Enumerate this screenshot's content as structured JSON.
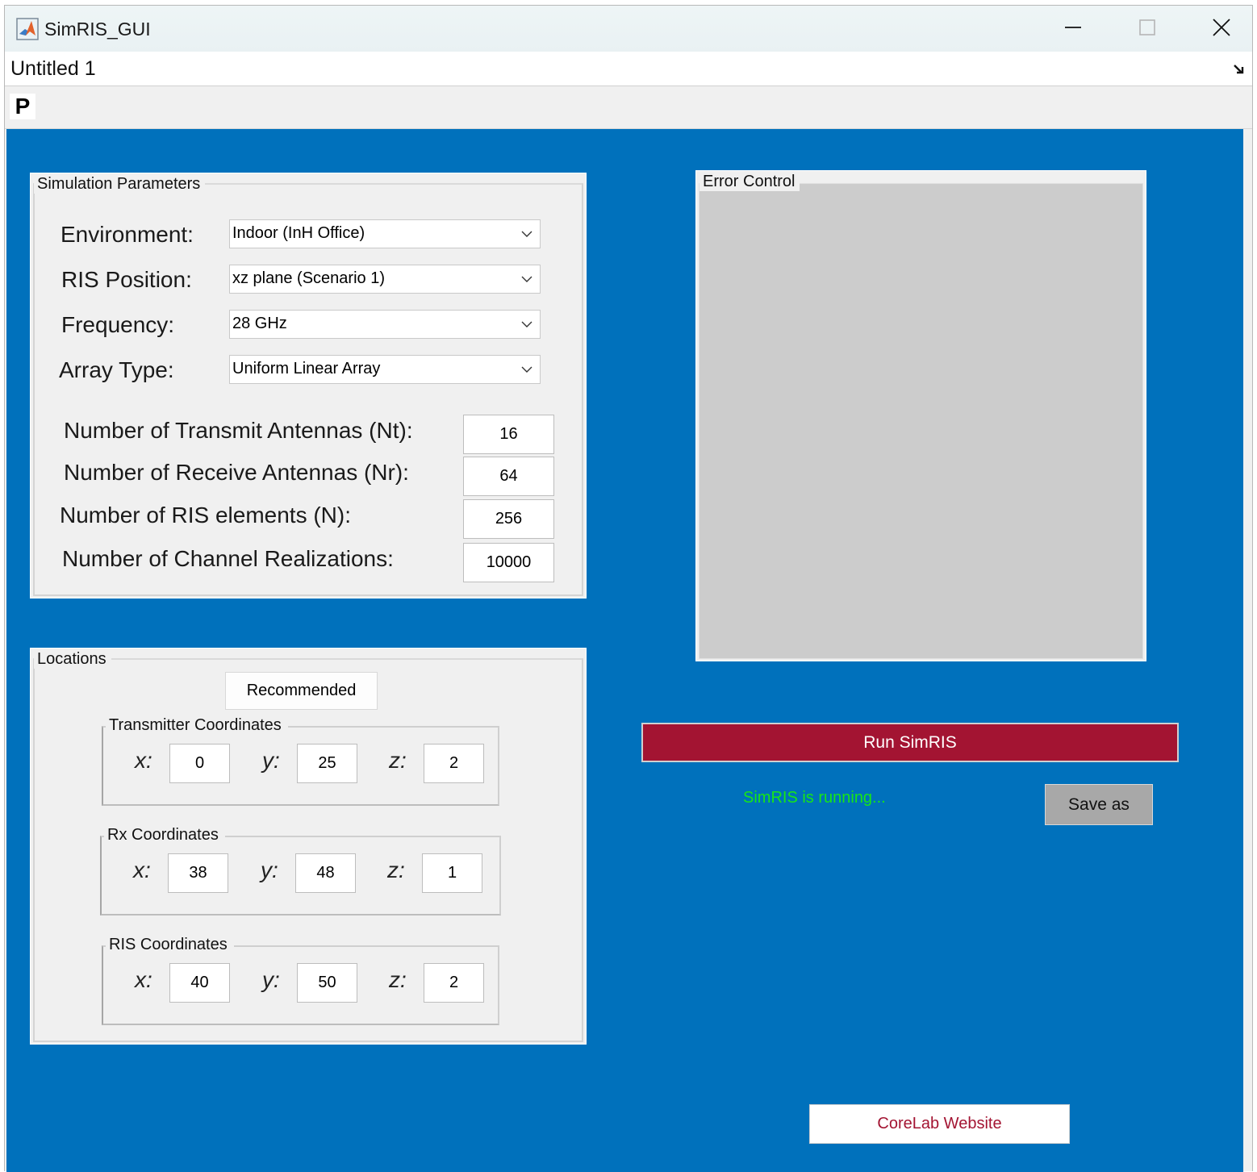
{
  "window": {
    "title": "SimRIS_GUI",
    "document_title": "Untitled 1",
    "toolbar_tool": "P"
  },
  "simulation": {
    "title": "Simulation Parameters",
    "environment": {
      "label": "Environment:",
      "value": "Indoor (InH Office)"
    },
    "ris_position": {
      "label": "RIS Position:",
      "value": "xz plane (Scenario 1)"
    },
    "frequency": {
      "label": "Frequency:",
      "value": "28 GHz"
    },
    "array_type": {
      "label": "Array Type:",
      "value": "Uniform Linear Array"
    },
    "nt": {
      "label": "Number of Transmit Antennas (Nt):",
      "value": "16"
    },
    "nr": {
      "label": "Number of Receive Antennas (Nr):",
      "value": "64"
    },
    "n": {
      "label": "Number of RIS elements (N):",
      "value": "256"
    },
    "realizations": {
      "label": "Number of Channel Realizations:",
      "value": "10000"
    }
  },
  "locations": {
    "title": "Locations",
    "recommended_label": "Recommended",
    "axis": {
      "x": "x:",
      "y": "y:",
      "z": "z:"
    },
    "tx": {
      "title": "Transmitter Coordinates",
      "x": "0",
      "y": "25",
      "z": "2"
    },
    "rx": {
      "title": "Rx Coordinates",
      "x": "38",
      "y": "48",
      "z": "1"
    },
    "ris": {
      "title": "RIS Coordinates",
      "x": "40",
      "y": "50",
      "z": "2"
    }
  },
  "error_control": {
    "title": "Error Control"
  },
  "actions": {
    "run_label": "Run SimRIS",
    "status_text": "SimRIS is running...",
    "save_label": "Save as",
    "website_label": "CoreLab Website"
  },
  "colors": {
    "canvas_bg": "#0071bc",
    "run_button": "#a31432",
    "status_text": "#17e617",
    "save_button": "#a8a8a8",
    "error_area": "#cccccc"
  },
  "icons": {
    "app": "matlab-logo-icon",
    "minimize": "minimize-icon",
    "maximize": "maximize-icon",
    "close": "close-icon",
    "dropdown": "chevron-down-icon",
    "dock": "undock-arrow-icon"
  }
}
